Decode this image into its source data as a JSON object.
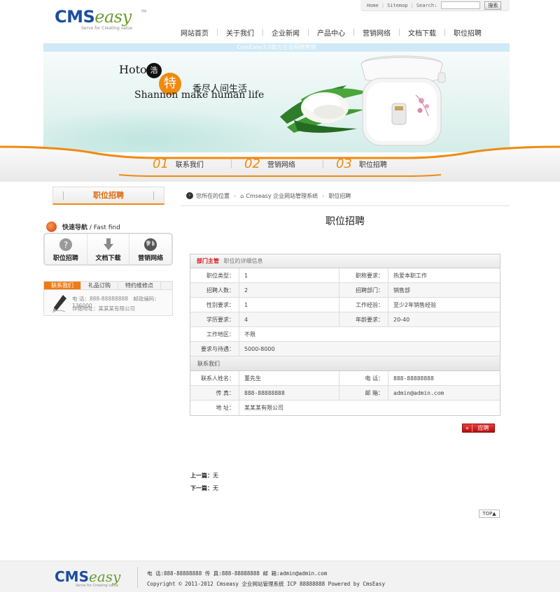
{
  "topbar": {
    "home": "Home",
    "sitemap": "Sitemap",
    "search_label": "Search:",
    "search_value": "",
    "search_button": "搜索"
  },
  "logo": {
    "brand_1": "CMS",
    "brand_2": "easy",
    "tm": "TM",
    "tagline": "Serve for Creating value"
  },
  "nav": [
    "网站首页",
    "关于我们",
    "企业新闻",
    "产品中心",
    "营销网络",
    "文档下载",
    "职位招聘"
  ],
  "banner": {
    "marquee": "CmsEasy3.0助力企业网络营销",
    "ho": "Hotor",
    "seal_1": "浩",
    "seal_2": "特",
    "slogan": "香尽人间生活",
    "english": "Shannon make human life"
  },
  "tabs": [
    {
      "num": "01",
      "label": "联系我们"
    },
    {
      "num": "02",
      "label": "营销网络"
    },
    {
      "num": "03",
      "label": "职位招聘"
    }
  ],
  "sidebar": {
    "heading": "职位招聘",
    "quick_title": "快速导航",
    "quick_sub": "/ Fast find",
    "quick_items": [
      {
        "label": "职位招聘",
        "icon": "question-icon"
      },
      {
        "label": "文档下载",
        "icon": "download-arrow-icon"
      },
      {
        "label": "营销网络",
        "icon": "globe-icon"
      }
    ],
    "contact_tabs": [
      "联系我们",
      "礼品订购",
      "特约维修点"
    ],
    "contact_phone": "电  话：888-88888888",
    "contact_zip": "邮政编码：136000",
    "contact_address": "详细地址：某某某有限公司"
  },
  "breadcrumb": {
    "prefix": "您所在的位置",
    "site": "Cmseasy 企业网站管理系统",
    "current": "职位招聘"
  },
  "page_title": "职位招聘",
  "job": {
    "dept": "部门主管",
    "dept_note": "职位的详细信息",
    "rows": [
      {
        "k1": "职位类型：",
        "v1": "1",
        "k2": "职称要求：",
        "v2": "热爱本职工作"
      },
      {
        "k1": "招聘人数：",
        "v1": "2",
        "k2": "招聘部门：",
        "v2": "销售部"
      },
      {
        "k1": "性别要求：",
        "v1": "1",
        "k2": "工作经验：",
        "v2": "至少2年销售经验"
      },
      {
        "k1": "学历要求：",
        "v1": "4",
        "k2": "年龄要求：",
        "v2": "20-40"
      }
    ],
    "area_label": "工作地区：",
    "area_value": "不限",
    "salary_label": "要求与待遇：",
    "salary_value": "5000-8000",
    "contact_heading": "联系我们",
    "contact_rows": [
      {
        "k1": "联系人姓名：",
        "v1": "董先生",
        "k2": "电  话：",
        "v2": "888-88888888"
      },
      {
        "k1": "传  真：",
        "v1": "888-88888888",
        "k2": "邮  箱：",
        "v2": "admin@admin.com"
      }
    ],
    "address_label": "地  址：",
    "address_value": "某某某有限公司"
  },
  "apply": {
    "arrow": "«",
    "label": "应聘"
  },
  "prev": {
    "label": "上一篇：",
    "value": "无"
  },
  "next": {
    "label": "下一篇：",
    "value": "无"
  },
  "top_button": "TOP▲",
  "footer": {
    "line_1": "电 话:888-88888888  传 真:888-88888888  邮 箱:admin@admin.com",
    "line_2": "Copyright © 2011-2012  Cmseasy 企业网站管理系统  ICP 88888888  Powered by CmsEasy"
  },
  "colors": {
    "accent_orange": "#f08a10",
    "brand_blue": "#1c4e9e",
    "brand_green": "#6a9c2e",
    "apply_red": "#d2161c"
  }
}
